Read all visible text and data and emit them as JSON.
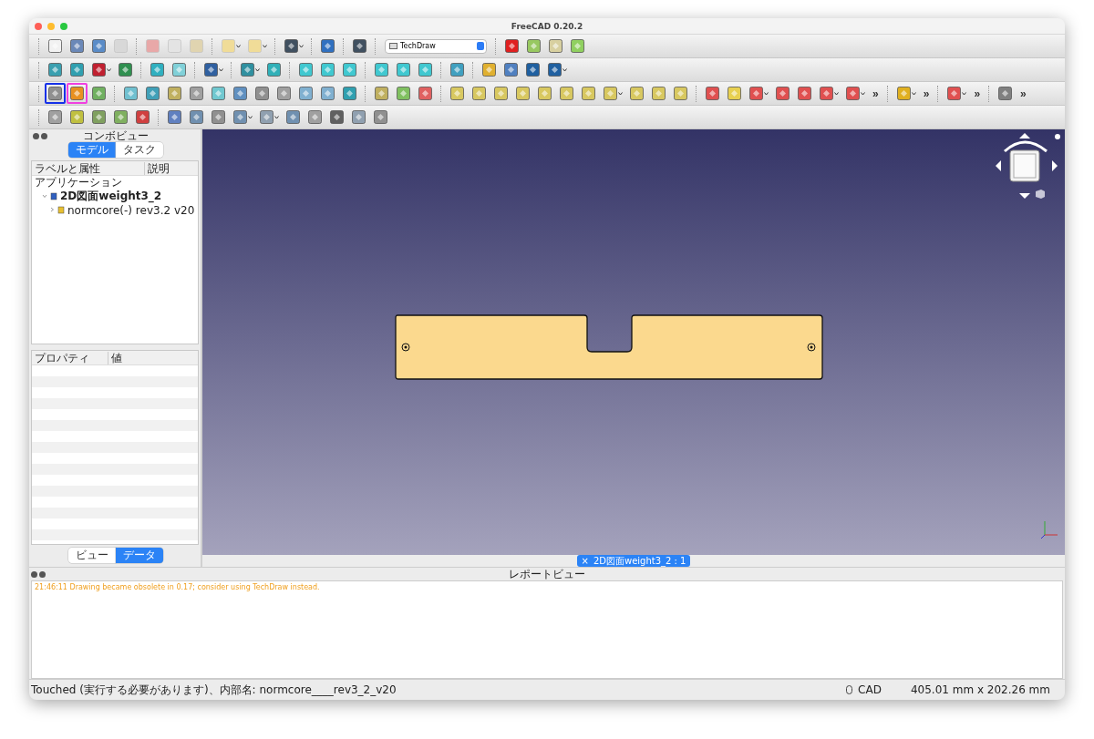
{
  "window": {
    "title": "FreeCAD 0.20.2"
  },
  "toolbars": [
    [
      {
        "kind": "tool",
        "color": "#f2f2f2",
        "dropdown": false,
        "disabled": false
      },
      {
        "kind": "tool",
        "color": "#6a88b8",
        "dropdown": false,
        "disabled": false
      },
      {
        "kind": "tool",
        "color": "#5a8cc8",
        "dropdown": false,
        "disabled": false
      },
      {
        "kind": "tool",
        "color": "#d8d8d8",
        "dropdown": false,
        "disabled": true
      },
      {
        "kind": "separator"
      },
      {
        "kind": "tool",
        "color": "#e8a8a8",
        "dropdown": false,
        "disabled": true
      },
      {
        "kind": "tool",
        "color": "#e4e4e4",
        "dropdown": false,
        "disabled": true
      },
      {
        "kind": "tool",
        "color": "#e0d4b0",
        "dropdown": false,
        "disabled": true
      },
      {
        "kind": "separator"
      },
      {
        "kind": "tool",
        "color": "#f0dc98",
        "dropdown": true,
        "disabled": true
      },
      {
        "kind": "tool",
        "color": "#f0dc98",
        "dropdown": true,
        "disabled": true
      },
      {
        "kind": "separator"
      },
      {
        "kind": "tool",
        "color": "#405060",
        "dropdown": true,
        "disabled": false
      },
      {
        "kind": "separator"
      },
      {
        "kind": "tool",
        "color": "#3070c0",
        "dropdown": false,
        "disabled": false
      },
      {
        "kind": "separator"
      },
      {
        "kind": "tool",
        "color": "#405060",
        "dropdown": false,
        "disabled": false
      },
      {
        "kind": "separator"
      },
      {
        "kind": "combo",
        "value": "TechDraw"
      },
      {
        "kind": "separator"
      },
      {
        "kind": "tool",
        "color": "#e02020",
        "dropdown": false,
        "disabled": false
      },
      {
        "kind": "tool",
        "color": "#98c860",
        "dropdown": false,
        "disabled": false
      },
      {
        "kind": "tool",
        "color": "#d8d0a0",
        "dropdown": false,
        "disabled": false
      },
      {
        "kind": "tool",
        "color": "#90d060",
        "dropdown": false,
        "disabled": false
      }
    ],
    [
      {
        "kind": "tool",
        "color": "#3aa0b0",
        "dropdown": false
      },
      {
        "kind": "tool",
        "color": "#30a0b0",
        "dropdown": false
      },
      {
        "kind": "tool",
        "color": "#c02030",
        "dropdown": true
      },
      {
        "kind": "tool",
        "color": "#309050",
        "dropdown": false
      },
      {
        "kind": "separator"
      },
      {
        "kind": "tool",
        "color": "#30b0c0",
        "dropdown": false
      },
      {
        "kind": "tool",
        "color": "#80d0d8",
        "dropdown": false
      },
      {
        "kind": "separator"
      },
      {
        "kind": "tool",
        "color": "#3060a0",
        "dropdown": true
      },
      {
        "kind": "separator"
      },
      {
        "kind": "tool",
        "color": "#3090a0",
        "dropdown": true
      },
      {
        "kind": "tool",
        "color": "#30b0b8",
        "dropdown": false
      },
      {
        "kind": "separator"
      },
      {
        "kind": "tool",
        "color": "#40c8d0",
        "dropdown": false
      },
      {
        "kind": "tool",
        "color": "#40c8d0",
        "dropdown": false
      },
      {
        "kind": "tool",
        "color": "#40c8d0",
        "dropdown": false
      },
      {
        "kind": "separator"
      },
      {
        "kind": "tool",
        "color": "#40c8d0",
        "dropdown": false
      },
      {
        "kind": "tool",
        "color": "#40c8d0",
        "dropdown": false
      },
      {
        "kind": "tool",
        "color": "#40c8d0",
        "dropdown": false
      },
      {
        "kind": "separator"
      },
      {
        "kind": "tool",
        "color": "#40a0c0",
        "dropdown": false
      },
      {
        "kind": "separator"
      },
      {
        "kind": "tool",
        "color": "#e0b030",
        "dropdown": false
      },
      {
        "kind": "tool",
        "color": "#5080c0",
        "dropdown": false
      },
      {
        "kind": "tool",
        "color": "#2060a0",
        "dropdown": false
      },
      {
        "kind": "tool",
        "color": "#2060a0",
        "dropdown": true
      }
    ],
    [
      {
        "kind": "framed_tool",
        "color": "#1530e8",
        "tool": {
          "color": "#909090",
          "dropdown": false
        }
      },
      {
        "kind": "framed_tool",
        "color": "#f040e0",
        "tool": {
          "color": "#e89020",
          "dropdown": false
        }
      },
      {
        "kind": "tool",
        "color": "#70b060",
        "dropdown": false
      },
      {
        "kind": "separator"
      },
      {
        "kind": "tool",
        "color": "#70c0d0",
        "dropdown": false
      },
      {
        "kind": "tool",
        "color": "#40a0b8",
        "dropdown": false
      },
      {
        "kind": "tool",
        "color": "#c0b060",
        "dropdown": false
      },
      {
        "kind": "tool",
        "color": "#a0a0a0",
        "dropdown": false
      },
      {
        "kind": "tool",
        "color": "#70c8d0",
        "dropdown": false
      },
      {
        "kind": "tool",
        "color": "#6090c0",
        "dropdown": false
      },
      {
        "kind": "tool",
        "color": "#909090",
        "dropdown": false
      },
      {
        "kind": "tool",
        "color": "#a0a0a0",
        "dropdown": false
      },
      {
        "kind": "tool",
        "color": "#80b0d0",
        "dropdown": false
      },
      {
        "kind": "tool",
        "color": "#80b0d0",
        "dropdown": false
      },
      {
        "kind": "tool",
        "color": "#30a0b0",
        "dropdown": false
      },
      {
        "kind": "separator"
      },
      {
        "kind": "tool",
        "color": "#c0b060",
        "dropdown": false
      },
      {
        "kind": "tool",
        "color": "#80c060",
        "dropdown": false
      },
      {
        "kind": "tool",
        "color": "#e06060",
        "dropdown": false
      },
      {
        "kind": "separator"
      },
      {
        "kind": "tool",
        "color": "#d8c860",
        "dropdown": false
      },
      {
        "kind": "tool",
        "color": "#d8c860",
        "dropdown": false
      },
      {
        "kind": "tool",
        "color": "#d8c860",
        "dropdown": false
      },
      {
        "kind": "tool",
        "color": "#d8c860",
        "dropdown": false
      },
      {
        "kind": "tool",
        "color": "#d8c860",
        "dropdown": false
      },
      {
        "kind": "tool",
        "color": "#d8c860",
        "dropdown": false
      },
      {
        "kind": "tool",
        "color": "#d8c860",
        "dropdown": false
      },
      {
        "kind": "tool",
        "color": "#d8c860",
        "dropdown": true
      },
      {
        "kind": "tool",
        "color": "#d8c860",
        "dropdown": false
      },
      {
        "kind": "tool",
        "color": "#d8c860",
        "dropdown": false
      },
      {
        "kind": "tool",
        "color": "#d8c860",
        "dropdown": false
      },
      {
        "kind": "separator"
      },
      {
        "kind": "tool",
        "color": "#e05050",
        "dropdown": false
      },
      {
        "kind": "tool",
        "color": "#e8d050",
        "dropdown": false
      },
      {
        "kind": "tool",
        "color": "#e05050",
        "dropdown": true
      },
      {
        "kind": "tool",
        "color": "#e05050",
        "dropdown": false
      },
      {
        "kind": "tool",
        "color": "#e05050",
        "dropdown": false
      },
      {
        "kind": "tool",
        "color": "#e05050",
        "dropdown": true
      },
      {
        "kind": "tool",
        "color": "#e05050",
        "dropdown": true
      },
      {
        "kind": "more",
        "label": "»"
      },
      {
        "kind": "separator"
      },
      {
        "kind": "tool",
        "color": "#e0b020",
        "dropdown": true
      },
      {
        "kind": "more",
        "label": "»"
      },
      {
        "kind": "separator"
      },
      {
        "kind": "tool",
        "color": "#e05050",
        "dropdown": true
      },
      {
        "kind": "more",
        "label": "»"
      },
      {
        "kind": "separator"
      },
      {
        "kind": "tool",
        "color": "#808080",
        "dropdown": false
      },
      {
        "kind": "more",
        "label": "»"
      }
    ],
    [
      {
        "kind": "tool",
        "color": "#a0a0a0",
        "dropdown": false
      },
      {
        "kind": "tool",
        "color": "#c0c040",
        "dropdown": false
      },
      {
        "kind": "tool",
        "color": "#80a060",
        "dropdown": false
      },
      {
        "kind": "tool",
        "color": "#80b060",
        "dropdown": false
      },
      {
        "kind": "tool",
        "color": "#d04040",
        "dropdown": false
      },
      {
        "kind": "separator"
      },
      {
        "kind": "tool",
        "color": "#6080c0",
        "dropdown": false
      },
      {
        "kind": "tool",
        "color": "#7090b0",
        "dropdown": false
      },
      {
        "kind": "tool",
        "color": "#909090",
        "dropdown": false
      },
      {
        "kind": "tool",
        "color": "#7090b0",
        "dropdown": true
      },
      {
        "kind": "tool",
        "color": "#90a0b0",
        "dropdown": true
      },
      {
        "kind": "tool",
        "color": "#7090b0",
        "dropdown": false
      },
      {
        "kind": "tool",
        "color": "#a0a0a0",
        "dropdown": false
      },
      {
        "kind": "tool",
        "color": "#606060",
        "dropdown": false
      },
      {
        "kind": "tool",
        "color": "#90a0b0",
        "dropdown": false
      },
      {
        "kind": "tool",
        "color": "#909090",
        "dropdown": false
      }
    ]
  ],
  "combo_view": {
    "title": "コンボビュー",
    "tabs": [
      {
        "label": "モデル",
        "selected": true
      },
      {
        "label": "タスク",
        "selected": false
      }
    ],
    "tree_columns": [
      "ラベルと属性",
      "説明"
    ],
    "tree": [
      {
        "label": "アプリケーション",
        "children": [
          {
            "label": "2D図面weight3_2",
            "expanded": true,
            "children": [
              {
                "label": "normcore(-) rev3.2 v20",
                "expanded": false
              }
            ]
          }
        ]
      }
    ],
    "property_columns": [
      "プロパティ",
      "値"
    ],
    "bottom_tabs": [
      {
        "label": "ビュー",
        "selected": false
      },
      {
        "label": "データ",
        "selected": true
      }
    ]
  },
  "document_tab": {
    "close": "×",
    "label": "2D図面weight3_2 : 1"
  },
  "report_view": {
    "title": "レポートビュー",
    "messages": [
      "21:46:11  Drawing became obsolete in 0.17; consider using TechDraw instead."
    ]
  },
  "status_bar": {
    "message": "Touched (実行する必要があります)、内部名: normcore____rev3_2_v20",
    "navigation": "CAD",
    "dimensions": "405.01 mm x 202.26 mm"
  }
}
